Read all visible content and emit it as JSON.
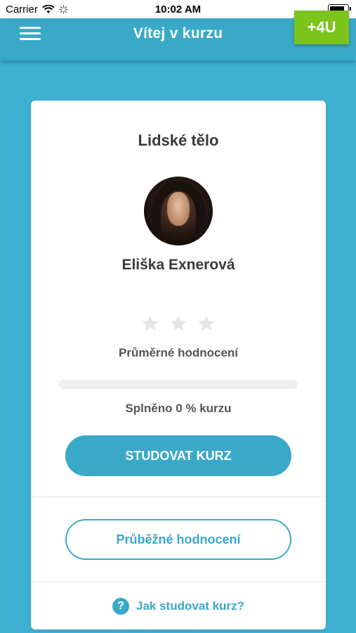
{
  "status_bar": {
    "carrier": "Carrier",
    "time": "10:02 AM"
  },
  "header": {
    "title": "Vítej v kurzu",
    "logo_text": "+4U"
  },
  "course": {
    "title": "Lidské tělo",
    "teacher_name": "Eliška Exnerová",
    "rating": {
      "value": 0,
      "max": 3
    },
    "rating_label": "Průměrné hodnocení",
    "progress_percent": 0,
    "progress_label": "Splněno 0 % kurzu",
    "study_button": "STUDOVAT KURZ",
    "evaluation_button": "Průběžné hodnocení",
    "help_link": "Jak studovat kurz?",
    "help_icon": "?"
  },
  "colors": {
    "background": "#3eb1d3",
    "header": "#3aa9c8",
    "accent": "#3aa9c8",
    "logo": "#7bc41b",
    "star_empty": "#e6e6e6"
  }
}
